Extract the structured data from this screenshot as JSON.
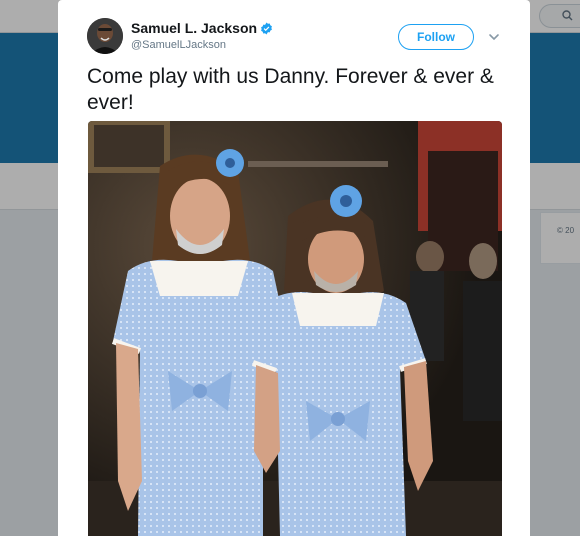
{
  "background_page": {
    "copyright_text": "© 20"
  },
  "tweet": {
    "author": {
      "display_name": "Samuel L. Jackson",
      "handle": "@SamuelLJackson",
      "verified": true
    },
    "follow_label": "Follow",
    "text": "Come play with us Danny. Forever & ever & ever!",
    "media": {
      "kind": "photo"
    }
  },
  "colors": {
    "accent": "#1da1f2",
    "text_primary": "#14171a",
    "text_secondary": "#657786",
    "banner": "#1e7bb0"
  },
  "icons": {
    "verified": "verified-badge-icon",
    "caret": "chevron-down-icon",
    "search": "search-icon"
  }
}
